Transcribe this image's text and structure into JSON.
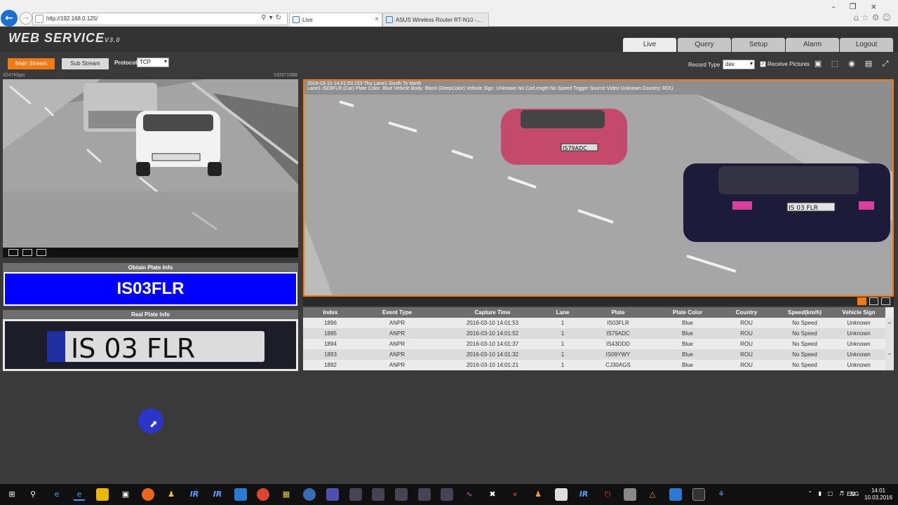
{
  "browser": {
    "url": "http://192.168.0.125/",
    "tabs": [
      {
        "label": "Live"
      },
      {
        "label": "ASUS Wireless Router RT-N10 -..."
      }
    ]
  },
  "app": {
    "logo": "WEB  SERVICE",
    "logo_version": "V3.0",
    "nav_tabs": [
      "Live",
      "Query",
      "Setup",
      "Alarm",
      "Logout"
    ],
    "active_tab": "Live"
  },
  "toolbar": {
    "main_stream": "Main Stream",
    "sub_stream": "Sub Stream",
    "protocol_label": "Protocol",
    "protocol_value": "TCP",
    "record_type_label": "Record Type",
    "record_type_value": "dav",
    "receive_pictures_label": "Receive Pictures",
    "receive_pictures_checked": true
  },
  "left_video": {
    "bitrate": "3247Kbps",
    "resolution": "1920*1088",
    "plate_text": "IS 03 FLR"
  },
  "obtain_plate": {
    "title": "Obtain Plate Info",
    "plate": "IS03FLR",
    "bg_color": "#0000ff"
  },
  "real_plate": {
    "title": "Real Plate Info",
    "plate_image_text": "IS 03 FLR"
  },
  "right_video": {
    "overlay_line1": "2016-03-10 14:01:53.233 Thu Lane1 South To North",
    "overlay_line2": "Lane1 IS03FLR (Car) Plate Color: Blue Vehicle Body: Black (DeepColor) Vehicle Sign: Unknown No CarLength No Speed Trigger Source:Video Unknown Country: ROU",
    "car1_plate": "IS79ADC",
    "car2_plate": "IS 03 FLR"
  },
  "table": {
    "columns": [
      "Index",
      "Event Type",
      "Capture Time",
      "Lane",
      "Plate",
      "Plate Color",
      "Country",
      "Speed(km/h)",
      "Vehicle Sign"
    ],
    "rows": [
      [
        "1896",
        "ANPR",
        "2016-03-10 14:01:53",
        "1",
        "IS03FLR",
        "Blue",
        "ROU",
        "No Speed",
        "Unknown"
      ],
      [
        "1895",
        "ANPR",
        "2016-03-10 14:01:52",
        "1",
        "IS79ADC",
        "Blue",
        "ROU",
        "No Speed",
        "Unknown"
      ],
      [
        "1894",
        "ANPR",
        "2016-03-10 14:01:37",
        "1",
        "IS43DDD",
        "Blue",
        "ROU",
        "No Speed",
        "Unknown"
      ],
      [
        "1893",
        "ANPR",
        "2016-03-10 14:01:32",
        "1",
        "IS09YWY",
        "Blue",
        "ROU",
        "No Speed",
        "Unknown"
      ],
      [
        "1892",
        "ANPR",
        "2016-03-10 14:01:21",
        "1",
        "CJ30AGS",
        "Blue",
        "ROU",
        "No Speed",
        "Unknown"
      ]
    ]
  },
  "taskbar": {
    "lang": "ENG",
    "time": "14:01",
    "date": "10.03.2016"
  },
  "colors": {
    "accent": "#f07a14",
    "plate_blue": "#0000ff"
  }
}
